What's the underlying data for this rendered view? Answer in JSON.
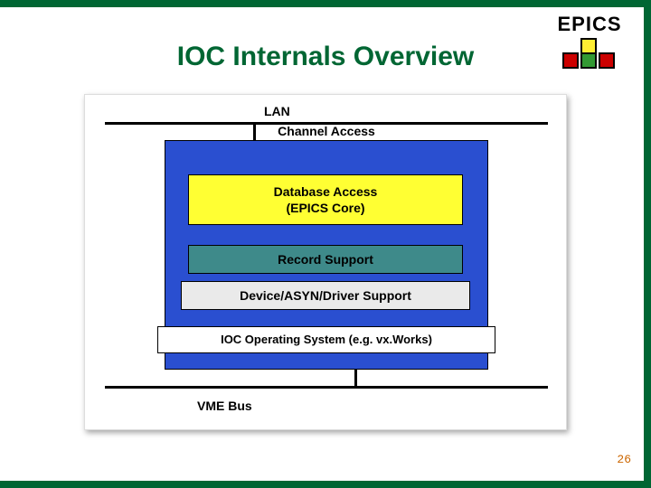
{
  "brand": {
    "name": "EPICS"
  },
  "title": "IOC Internals Overview",
  "diagram": {
    "lan_label": "LAN",
    "channel_access": "Channel Access",
    "database_access_line1": "Database Access",
    "database_access_line2": "(EPICS Core)",
    "record_support": "Record Support",
    "device_support": "Device/ASYN/Driver Support",
    "os_note": "IOC Operating System (e.g. vx.Works)",
    "vme_label": "VME Bus"
  },
  "footer": {
    "page_number": "26"
  },
  "colors": {
    "accent_green": "#006633",
    "blue": "#2a4fd0",
    "yellow": "#ffff33",
    "teal": "#3e8a8a",
    "red": "#cc0000",
    "logo_green": "#339933",
    "logo_yellow": "#ffee33"
  }
}
